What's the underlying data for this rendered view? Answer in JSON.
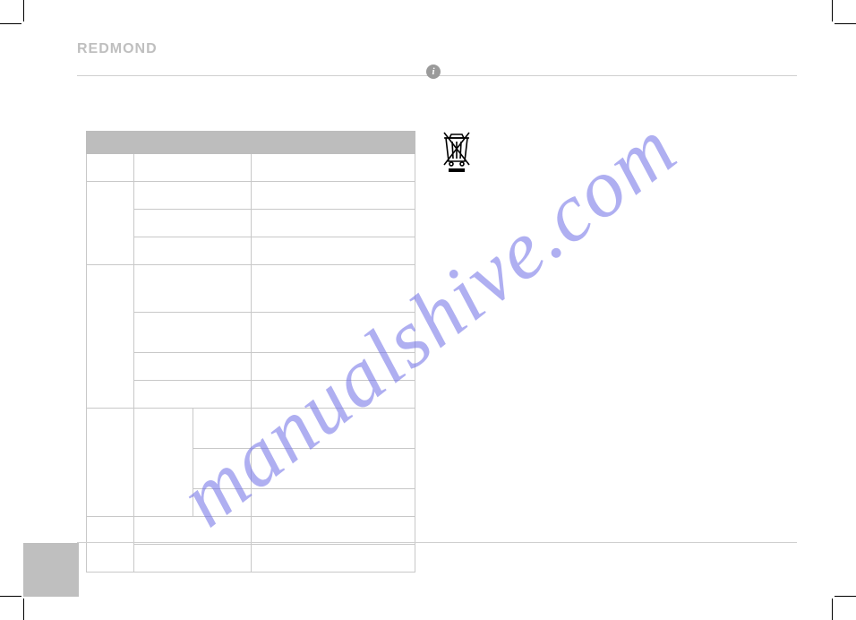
{
  "brand": "REDMOND",
  "info_icon_glyph": "i",
  "watermark": "manualshive.com",
  "icons": {
    "weee_name": "weee-bin-icon",
    "info_name": "info-icon"
  },
  "table": {
    "headers": [
      "",
      "",
      ""
    ],
    "rows": [
      {
        "h": "30",
        "cells": [
          "",
          "",
          ""
        ]
      },
      {
        "h": "30",
        "cells_span": [
          {
            "txt": "",
            "rowspan": 3
          },
          {
            "txt": ""
          },
          {
            "txt": ""
          }
        ]
      },
      {
        "h": "30",
        "cells": [
          "",
          ""
        ]
      },
      {
        "h": "30",
        "cells": [
          "",
          ""
        ]
      },
      {
        "h": "50",
        "cells_span": [
          {
            "txt": "",
            "rowspan": 4
          },
          {
            "txt": ""
          },
          {
            "txt": ""
          }
        ]
      },
      {
        "h": "44",
        "cells": [
          "",
          ""
        ]
      },
      {
        "h": "30",
        "cells": [
          "",
          ""
        ]
      },
      {
        "h": "30",
        "cells": [
          "",
          ""
        ]
      },
      {
        "h": "44",
        "cells_span": [
          {
            "txt": "",
            "rowspan": 3
          },
          {
            "txt": "",
            "rowspan": 3
          },
          {
            "txt": ""
          },
          {
            "txt": ""
          }
        ]
      },
      {
        "h": "44",
        "cells": [
          "",
          ""
        ]
      },
      {
        "h": "30",
        "cells": [
          "",
          ""
        ]
      },
      {
        "h": "30",
        "cells_span": [
          {
            "txt": "",
            "rowspan": 2
          },
          {
            "txt": "",
            "colspan": 2
          },
          {
            "txt": ""
          }
        ]
      },
      {
        "h": "30",
        "cells": [
          {
            "txt": "",
            "colspan": 2
          },
          {
            "txt": ""
          }
        ]
      }
    ]
  }
}
